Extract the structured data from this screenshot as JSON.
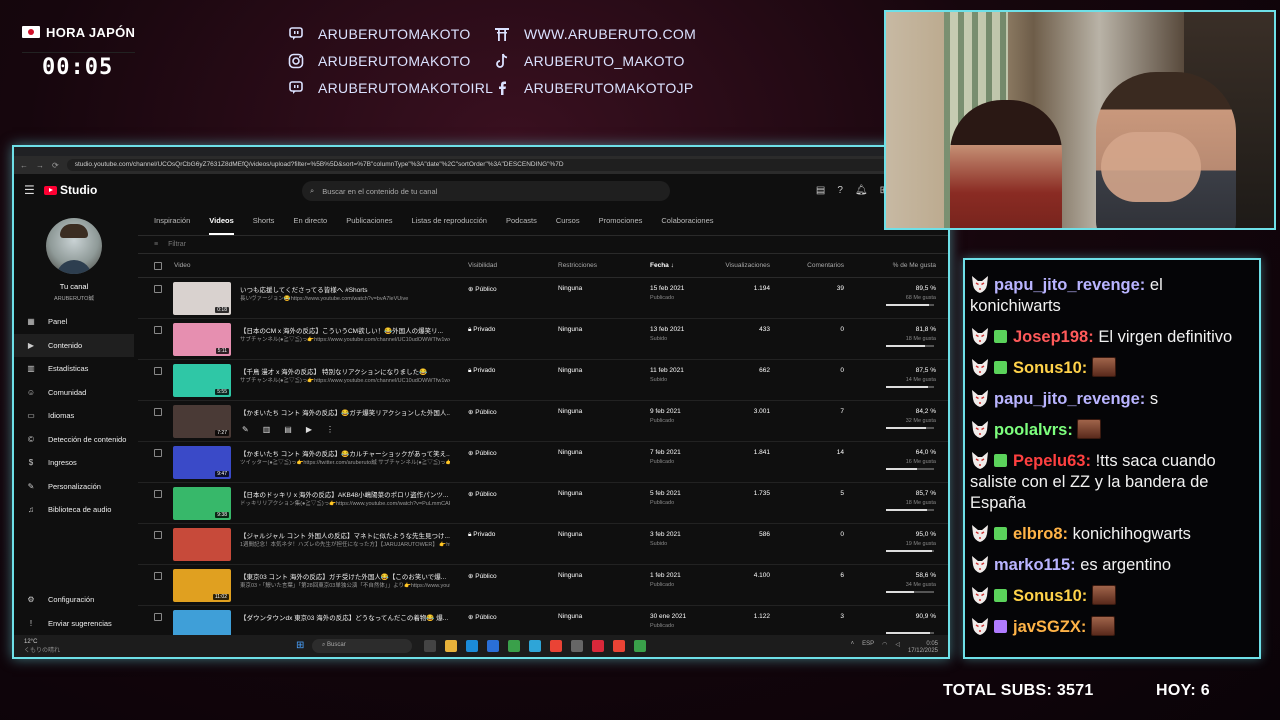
{
  "overlay": {
    "clock_label": "HORA JAPÓN",
    "clock_time": "00:05",
    "socials": [
      {
        "icon": "twitch-icon",
        "text": "ARUBERUTOMAKOTO"
      },
      {
        "icon": "torii-icon",
        "text": "WWW.ARUBERUTO.COM"
      },
      {
        "icon": "instagram-icon",
        "text": "ARUBERUTOMAKOTO"
      },
      {
        "icon": "tiktok-icon",
        "text": "ARUBERUTO_MAKOTO"
      },
      {
        "icon": "twitch-icon",
        "text": "ARUBERUTOMAKOTOIRL"
      },
      {
        "icon": "facebook-icon",
        "text": "ARUBERUTOMAKOTOJP"
      }
    ],
    "total_subs": "TOTAL SUBS: 3571",
    "today": "HOY: 6"
  },
  "browser": {
    "url": "studio.youtube.com/channel/UCOsQrCbG6yZ7631Z8dMEfQ/videos/upload?filter=%5B%5D&sort=%7B\"columnType\"%3A\"date\"%2C\"sortOrder\"%3A\"DESCENDING\"%7D"
  },
  "studio": {
    "logo": "Studio",
    "search_placeholder": "Buscar en el contenido de tu canal",
    "channel_name": "Tu canal",
    "channel_handle": "ARUBERUTO誠",
    "nav": [
      {
        "label": "Panel",
        "icon": "dashboard-icon"
      },
      {
        "label": "Contenido",
        "icon": "content-icon"
      },
      {
        "label": "Estadísticas",
        "icon": "analytics-icon"
      },
      {
        "label": "Comunidad",
        "icon": "community-icon"
      },
      {
        "label": "Idiomas",
        "icon": "subtitles-icon"
      },
      {
        "label": "Detección de contenido",
        "icon": "copyright-icon"
      },
      {
        "label": "Ingresos",
        "icon": "earn-icon"
      },
      {
        "label": "Personalización",
        "icon": "customization-icon"
      },
      {
        "label": "Biblioteca de audio",
        "icon": "audio-library-icon"
      }
    ],
    "nav_bottom": [
      {
        "label": "Configuración",
        "icon": "gear-icon"
      },
      {
        "label": "Enviar sugerencias",
        "icon": "feedback-icon"
      }
    ],
    "tabs": [
      "Inspiración",
      "Videos",
      "Shorts",
      "En directo",
      "Publicaciones",
      "Listas de reproducción",
      "Podcasts",
      "Cursos",
      "Promociones",
      "Colaboraciones"
    ],
    "filter_placeholder": "Filtrar",
    "columns": {
      "video": "Video",
      "visibility": "Visibilidad",
      "restrictions": "Restricciones",
      "date": "Fecha ↓",
      "views": "Visualizaciones",
      "comments": "Comentarios",
      "likes": "% de Me gusta"
    },
    "rows": [
      {
        "title": "いつも応援してくださってる皆様へ #Shorts",
        "desc": "長いヴァージョン😂https://www.youtube.com/watch?v=bvA7leVUive",
        "duration": "0:18",
        "visibility": "Público",
        "restriction": "Ninguna",
        "date": "15 feb 2021",
        "status": "Publicado",
        "views": "1.194",
        "comments": "39",
        "like_pct": "89,5 %",
        "likes": "68 Me gusta",
        "like_ratio": 0.895,
        "thumb": "#d9d2cf"
      },
      {
        "title": "【日本のCM x 海外の反応】こういうCM欲しい！😂外国人の爆笑リ...",
        "desc": "サブチャンネル(●≧▽≦)っ👉https://www.youtube.com/channel/UC10udOWWTfw1wxellB2DO_g?...",
        "duration": "5:11",
        "visibility": "Privado",
        "restriction": "Ninguna",
        "date": "13 feb 2021",
        "status": "Subido",
        "views": "433",
        "comments": "0",
        "like_pct": "81,8 %",
        "likes": "18 Me gusta",
        "like_ratio": 0.818,
        "thumb": "#e68fb0"
      },
      {
        "title": "【千鳥 漫才 x 海外の反応】 特別なリアクションになりました😂",
        "desc": "サブチャンネル(●≧▽≦)っ👉https://www.youtube.com/channel/UC10udOWWTfw1wxellB2DO_g?...",
        "duration": "5:55",
        "visibility": "Privado",
        "restriction": "Ninguna",
        "date": "11 feb 2021",
        "status": "Subido",
        "views": "662",
        "comments": "0",
        "like_pct": "87,5 %",
        "likes": "14 Me gusta",
        "like_ratio": 0.875,
        "thumb": "#2fc7a6"
      },
      {
        "title": "【かまいたち コント 海外の反応】😂ガチ爆笑リアクションした外国人...",
        "desc": "",
        "duration": "7:27",
        "visibility": "Público",
        "restriction": "Ninguna",
        "date": "9 feb 2021",
        "status": "Publicado",
        "views": "3.001",
        "comments": "7",
        "like_pct": "84,2 %",
        "likes": "32 Me gusta",
        "like_ratio": 0.842,
        "thumb": "#4a3a36"
      },
      {
        "title": "【かまいたち コント 海外の反応】😂カルチャーショックがあって笑え...",
        "desc": "ツイッター(●≧▽≦)っ👉https://twitter.com/aruberuto誠 サブチャンネル(●≧▽≦)っ👉https://www.youtube.com/channel/UC10udOWWTfw1wxellB2DO_g?...",
        "duration": "9:47",
        "visibility": "Público",
        "restriction": "Ninguna",
        "date": "7 feb 2021",
        "status": "Publicado",
        "views": "1.841",
        "comments": "14",
        "like_pct": "64,0 %",
        "likes": "16 Me gusta",
        "like_ratio": 0.64,
        "thumb": "#3a4ac8"
      },
      {
        "title": "【日本のドッキリ x 海外の反応】AKB48小嶋陽菜のポロリ盗作パンツ...",
        "desc": "ドッキリリアクション集(●≧▽≦)っ👉https://www.youtube.com/watch?v=PuLmmCAFM8&list=PLhL00VVTVg_n0Y47qm0L0g3A8oVYZ8Np サブ...",
        "duration": "9:38",
        "visibility": "Público",
        "restriction": "Ninguna",
        "date": "5 feb 2021",
        "status": "Publicado",
        "views": "1.735",
        "comments": "5",
        "like_pct": "85,7 %",
        "likes": "18 Me gusta",
        "like_ratio": 0.857,
        "thumb": "#37b86a"
      },
      {
        "title": "【ジャルジャル コント 外国人の反応】マネトに似たような先生見つけ...",
        "desc": "1週間記念！本気ネタ！ハズレの先生が担任になった方】【JARUJARUTOWER】 👉https://www.youtube.com/watch?v=ACtvUnalVYc...",
        "duration": "",
        "visibility": "Privado",
        "restriction": "Ninguna",
        "date": "3 feb 2021",
        "status": "Subido",
        "views": "586",
        "comments": "0",
        "like_pct": "95,0 %",
        "likes": "19 Me gusta",
        "like_ratio": 0.95,
        "thumb": "#c74a3a"
      },
      {
        "title": "【東京03 コント 海外の反応】ガチ受けた外国人😂【このお笑いで爆...",
        "desc": "東京03・「鰻いた言葉」「第28回東京03単独公演「不自然体」」より👉https://www.youtube.com/watch?v=b7-62_Nz2Hg ツイッター(●≧▽≦)っ👉",
        "duration": "11:02",
        "visibility": "Público",
        "restriction": "Ninguna",
        "date": "1 feb 2021",
        "status": "Publicado",
        "views": "4.100",
        "comments": "6",
        "like_pct": "58,6 %",
        "likes": "34 Me gusta",
        "like_ratio": 0.586,
        "thumb": "#e0a020"
      },
      {
        "title": "【ダウンタウンdx 東京03 海外の反応】どうなってんだこの着物😂 爆...",
        "desc": "",
        "duration": "",
        "visibility": "Público",
        "restriction": "Ninguna",
        "date": "30 ene 2021",
        "status": "Publicado",
        "views": "1.122",
        "comments": "3",
        "like_pct": "90,9 %",
        "likes": "",
        "like_ratio": 0.909,
        "thumb": "#3f9fd8"
      }
    ]
  },
  "taskbar": {
    "weather": "12°C",
    "weather_sub": "くもりの晴れ",
    "search": "Buscar",
    "lang": "ESP",
    "time": "0:05",
    "date": "17/12/2025"
  },
  "chat": [
    {
      "user": "papu_jito_revenge",
      "color": "#b9b4ff",
      "badge": "",
      "text": "el konichiwarts",
      "emote": false
    },
    {
      "user": "Josep198",
      "color": "#ff5a5a",
      "badge": "#5bd35b",
      "text": "El virgen definitivo",
      "emote": false
    },
    {
      "user": "Sonus10",
      "color": "#ffd24a",
      "badge": "#5bd35b",
      "text": "",
      "emote": true
    },
    {
      "user": "papu_jito_revenge",
      "color": "#b9b4ff",
      "badge": "",
      "text": "s",
      "emote": false
    },
    {
      "user": "poolalvrs",
      "color": "#7dff7d",
      "badge": "",
      "text": "",
      "emote": true
    },
    {
      "user": "Pepelu63",
      "color": "#ff4040",
      "badge": "#5bd35b",
      "text": "!tts saca cuando saliste con el ZZ y la bandera de España",
      "emote": false
    },
    {
      "user": "elbro8",
      "color": "#ffb347",
      "badge": "#5bd35b",
      "text": "konichihogwarts",
      "emote": false
    },
    {
      "user": "marko115",
      "color": "#b9b4ff",
      "badge": "",
      "text": "es argentino",
      "emote": false
    },
    {
      "user": "Sonus10",
      "color": "#ffd24a",
      "badge": "#5bd35b",
      "text": "",
      "emote": true
    },
    {
      "user": "javSGZX",
      "color": "#ffb347",
      "badge": "#b07bff",
      "text": "",
      "emote": true
    }
  ]
}
